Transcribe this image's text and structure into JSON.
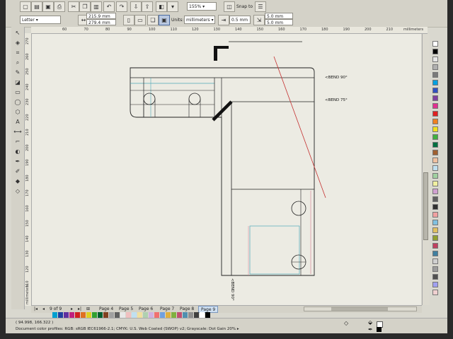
{
  "property_bar": {
    "preset": "Letter",
    "width": "215.9 mm",
    "height": "279.4 mm",
    "zoom": "155%",
    "snap_to": "Snap to",
    "units_label": "Units:",
    "units_value": "millimeters",
    "nudge": "0.5 mm",
    "dup_x": "5.0 mm",
    "dup_y": "5.0 mm"
  },
  "ruler": {
    "h_ticks": [
      "60",
      "70",
      "80",
      "90",
      "100",
      "110",
      "120",
      "130",
      "140",
      "150",
      "160",
      "170",
      "180",
      "190",
      "200",
      "210"
    ],
    "v_ticks": [
      "270",
      "260",
      "250",
      "240",
      "230",
      "220",
      "210",
      "200",
      "190",
      "180",
      "170",
      "160",
      "150",
      "140",
      "130",
      "120",
      "110"
    ],
    "unit": "millimeters",
    "v_unit": "millimeters"
  },
  "drawing": {
    "annotations": {
      "bend_90": "<BEND 90°",
      "bend_75": "<BEND 75°",
      "bend_90_vertical": "<BEND 90°"
    },
    "colors": {
      "outline": "#222222",
      "cyan": "#4fa8b8",
      "red": "#c43030",
      "pink": "#d87a90"
    }
  },
  "pages": {
    "counter": "9 of 9",
    "tabs": [
      "Page 4",
      "Page 5",
      "Page 6",
      "Page 7",
      "Page 8",
      "Page 9"
    ],
    "active": "Page 9"
  },
  "status": {
    "coordinates": "( 94.998, 166.322 )",
    "color_profiles": "Document color profiles: RGB: sRGB IEC61966-2.1; CMYK: U.S. Web Coated (SWOP) v2; Grayscale: Dot Gain 20% ▸"
  },
  "palette_colors": [
    "#ffffff",
    "#000000",
    "#e5e5e5",
    "#b0b0b0",
    "#7a7a7a",
    "#00a0e0",
    "#3050c0",
    "#8040a0",
    "#e03090",
    "#e02020",
    "#f08020",
    "#f0e020",
    "#40b040",
    "#007040",
    "#a06030",
    "#f0c0a0",
    "#c0e0f0",
    "#a0d0a0",
    "#f0f0a0",
    "#d0a0d0",
    "#606060",
    "#303030",
    "#f0a0a0",
    "#80c0e0",
    "#e0c060",
    "#90a030",
    "#c04060",
    "#4080a0",
    "#d0d0d0",
    "#9c9c9c",
    "#505050",
    "#a0a0f0",
    "#f0d0d0"
  ],
  "bottom_swatches": [
    "#00a0d0",
    "#2040a0",
    "#6030a0",
    "#c02080",
    "#d02020",
    "#e07020",
    "#e0d020",
    "#30a030",
    "#006030",
    "#804020",
    "#a0a0a0",
    "#606060",
    "#e8e8e8",
    "#f0c0c0",
    "#c0e0f0",
    "#f0e0a0",
    "#b0d0b0",
    "#d0b0e0",
    "#f07070",
    "#70a0e0",
    "#e0b040",
    "#80b040",
    "#c05070",
    "#5090b0",
    "#909090",
    "#404040",
    "#ffffff",
    "#000000"
  ]
}
